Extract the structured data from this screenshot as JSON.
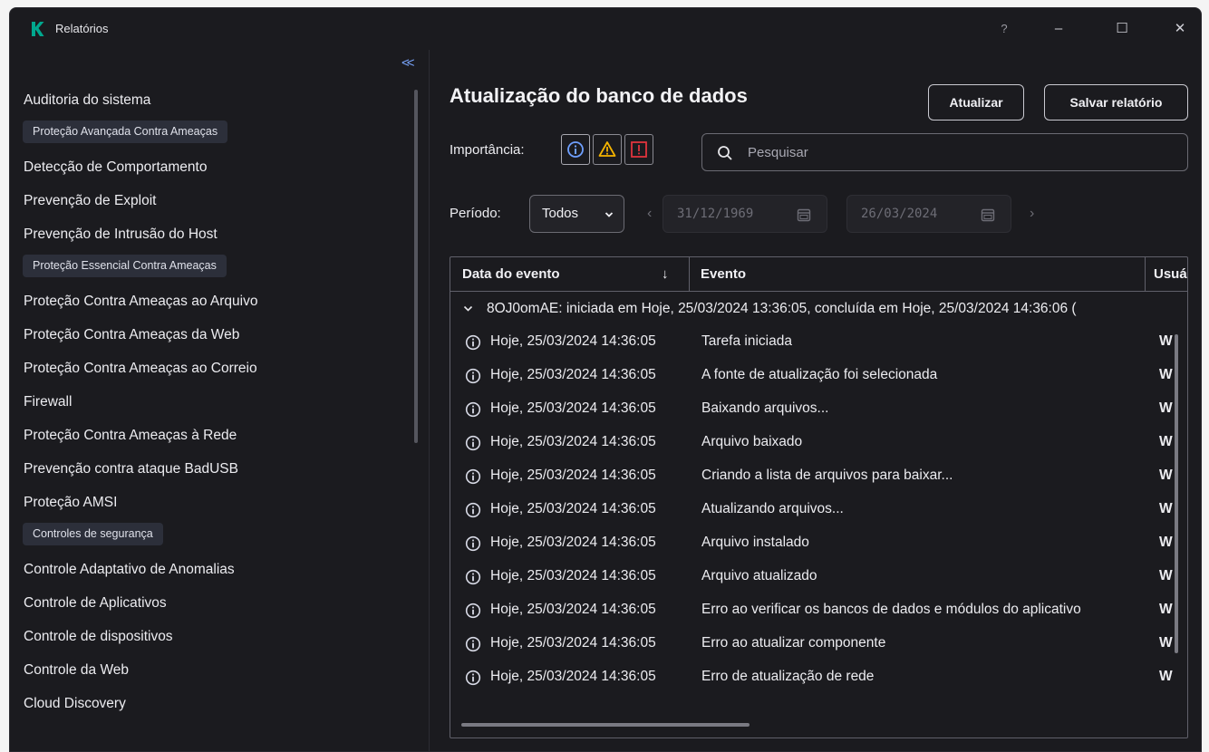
{
  "app": {
    "title": "Relatórios",
    "accent": "#00a88e",
    "brand_icon": "kaspersky-k-logo"
  },
  "titlebar": {
    "help": "?",
    "minimize": "–",
    "maximize": "☐",
    "close": "✕"
  },
  "sidebar": {
    "collapse": "<<",
    "entries": [
      {
        "kind": "item",
        "label": "Auditoria do sistema"
      },
      {
        "kind": "group",
        "label": "Proteção Avançada Contra Ameaças"
      },
      {
        "kind": "item",
        "label": "Detecção de Comportamento"
      },
      {
        "kind": "item",
        "label": "Prevenção de Exploit"
      },
      {
        "kind": "item",
        "label": "Prevenção de Intrusão do Host"
      },
      {
        "kind": "group",
        "label": "Proteção Essencial Contra Ameaças"
      },
      {
        "kind": "item",
        "label": "Proteção Contra Ameaças ao Arquivo"
      },
      {
        "kind": "item",
        "label": "Proteção Contra Ameaças da Web"
      },
      {
        "kind": "item",
        "label": "Proteção Contra Ameaças ao Correio"
      },
      {
        "kind": "item",
        "label": "Firewall"
      },
      {
        "kind": "item",
        "label": "Proteção Contra Ameaças à Rede"
      },
      {
        "kind": "item",
        "label": "Prevenção contra ataque BadUSB"
      },
      {
        "kind": "item",
        "label": "Proteção AMSI"
      },
      {
        "kind": "group",
        "label": "Controles de segurança"
      },
      {
        "kind": "item",
        "label": "Controle Adaptativo de Anomalias"
      },
      {
        "kind": "item",
        "label": "Controle de Aplicativos"
      },
      {
        "kind": "item",
        "label": "Controle de dispositivos"
      },
      {
        "kind": "item",
        "label": "Controle da Web"
      },
      {
        "kind": "item",
        "label": "Cloud Discovery"
      }
    ]
  },
  "main": {
    "title": "Atualização do banco de dados",
    "refresh_label": "Atualizar",
    "save_label": "Salvar relatório",
    "importance_label": "Importância:",
    "importance_icons": [
      "info-icon",
      "warning-icon",
      "error-icon"
    ],
    "search_placeholder": "Pesquisar",
    "period_label": "Período:",
    "period_value": "Todos",
    "date_from": "31/12/1969",
    "date_to": "26/03/2024",
    "colors": {
      "info": "#6fa0ff",
      "warning": "#f5b400",
      "error": "#e0343d"
    }
  },
  "table": {
    "headers": {
      "date": "Data do evento",
      "sort_indicator": "↓",
      "event": "Evento",
      "user": "Usuá"
    },
    "group_row": "8OJ0omAE: iniciada em Hoje, 25/03/2024 13:36:05, concluída em Hoje, 25/03/2024 14:36:06 (",
    "rows": [
      {
        "date": "Hoje, 25/03/2024 14:36:05",
        "event": "Tarefa iniciada",
        "user": "W"
      },
      {
        "date": "Hoje, 25/03/2024 14:36:05",
        "event": "A fonte de atualização foi selecionada",
        "user": "W"
      },
      {
        "date": "Hoje, 25/03/2024 14:36:05",
        "event": "Baixando arquivos...",
        "user": "W"
      },
      {
        "date": "Hoje, 25/03/2024 14:36:05",
        "event": "Arquivo baixado",
        "user": "W"
      },
      {
        "date": "Hoje, 25/03/2024 14:36:05",
        "event": "Criando a lista de arquivos para baixar...",
        "user": "W"
      },
      {
        "date": "Hoje, 25/03/2024 14:36:05",
        "event": "Atualizando arquivos...",
        "user": "W"
      },
      {
        "date": "Hoje, 25/03/2024 14:36:05",
        "event": "Arquivo instalado",
        "user": "W"
      },
      {
        "date": "Hoje, 25/03/2024 14:36:05",
        "event": "Arquivo atualizado",
        "user": "W"
      },
      {
        "date": "Hoje, 25/03/2024 14:36:05",
        "event": "Erro ao verificar os bancos de dados e módulos do aplicativo",
        "user": "W"
      },
      {
        "date": "Hoje, 25/03/2024 14:36:05",
        "event": "Erro ao atualizar componente",
        "user": "W"
      },
      {
        "date": "Hoje, 25/03/2024 14:36:05",
        "event": "Erro de atualização de rede",
        "user": "W"
      }
    ]
  }
}
